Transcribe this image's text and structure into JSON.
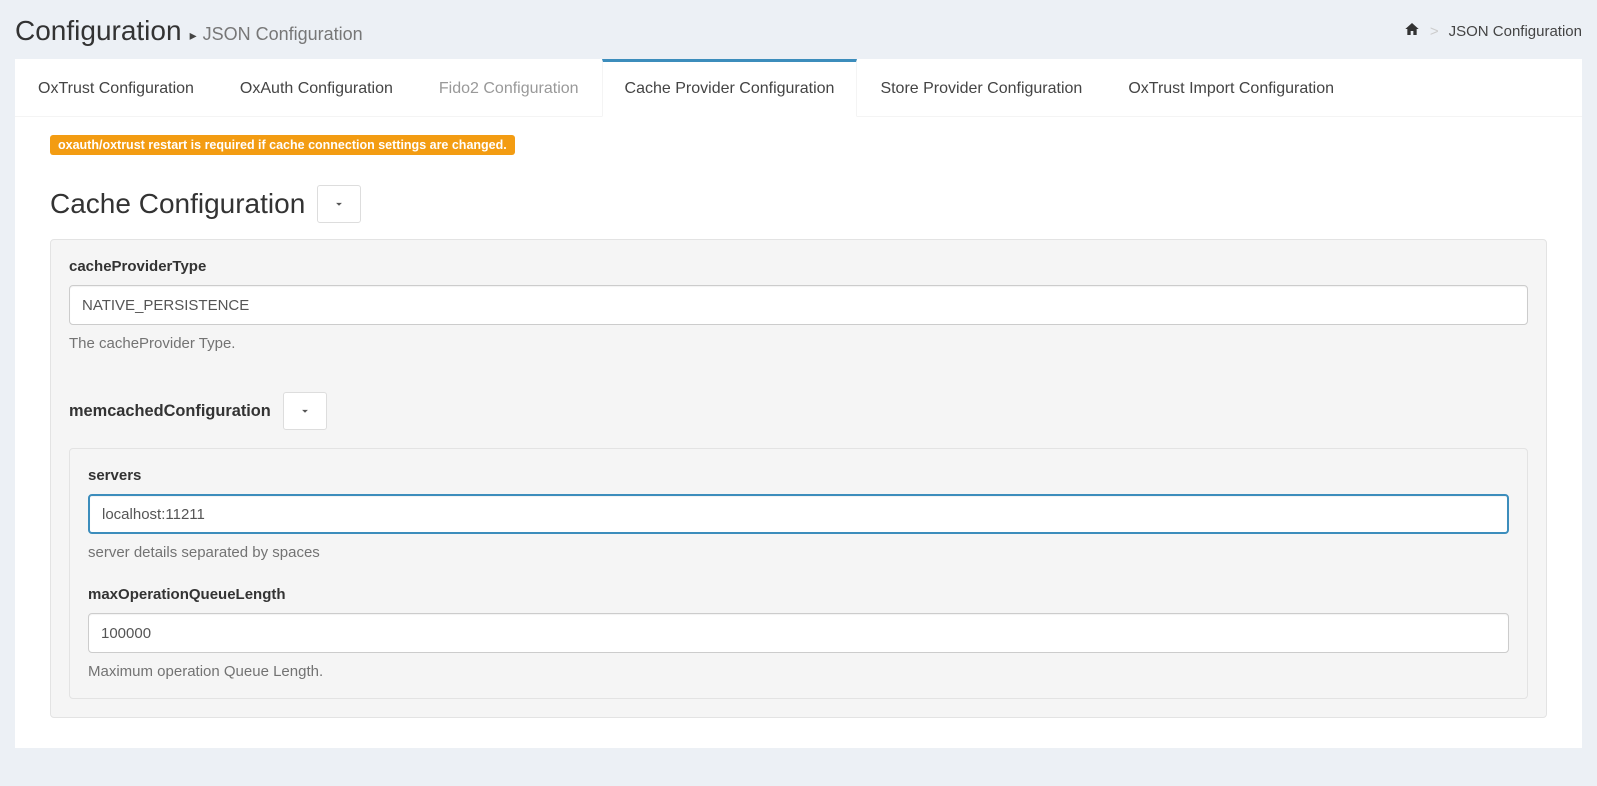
{
  "header": {
    "title": "Configuration",
    "subtitle": "JSON Configuration"
  },
  "breadcrumb": {
    "current": "JSON Configuration"
  },
  "tabs": {
    "oxtrust": "OxTrust Configuration",
    "oxauth": "OxAuth Configuration",
    "fido2": "Fido2 Configuration",
    "cache_provider": "Cache Provider Configuration",
    "store_provider": "Store Provider Configuration",
    "oxtrust_import": "OxTrust Import Configuration"
  },
  "warning": "oxauth/oxtrust restart is required if cache connection settings are changed.",
  "sections": {
    "cache_config": {
      "title": "Cache Configuration",
      "fields": {
        "cacheProviderType": {
          "label": "cacheProviderType",
          "value": "NATIVE_PERSISTENCE",
          "help": "The cacheProvider Type."
        }
      }
    },
    "memcached": {
      "title": "memcachedConfiguration",
      "fields": {
        "servers": {
          "label": "servers",
          "value": "localhost:11211",
          "help": "server details separated by spaces"
        },
        "maxOperationQueueLength": {
          "label": "maxOperationQueueLength",
          "value": "100000",
          "help": "Maximum operation Queue Length."
        }
      }
    }
  }
}
